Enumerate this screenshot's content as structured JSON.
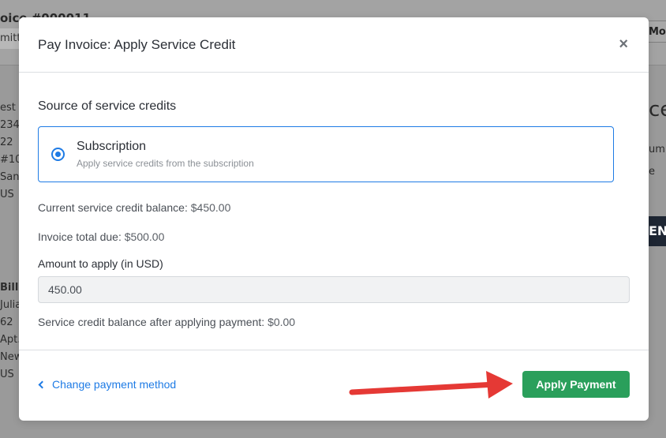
{
  "background": {
    "title": "oice #000011",
    "chip_text": "mitt",
    "more_button": "Mo",
    "left_lines_top": [
      "est",
      "234",
      "22",
      "#105",
      "San",
      "US"
    ],
    "left_lines_bottom_heading": "Bill T",
    "left_lines_bottom": [
      "Julia",
      "62",
      "Apt.",
      "New",
      "US"
    ],
    "right_big": "ce",
    "right_small": [
      "umb",
      "e"
    ],
    "right_block": "EN"
  },
  "modal": {
    "title": "Pay Invoice: Apply Service Credit",
    "close_label": "×",
    "section_title": "Source of service credits",
    "option": {
      "label": "Subscription",
      "description": "Apply service credits from the subscription",
      "selected": true
    },
    "current_balance_label": "Current service credit balance:",
    "current_balance_value": "$450.00",
    "invoice_total_label": "Invoice total due:",
    "invoice_total_value": "$500.00",
    "amount_label": "Amount to apply (in USD)",
    "amount_value": "450.00",
    "after_balance_label": "Service credit balance after applying payment:",
    "after_balance_value": "$0.00",
    "change_link": "Change payment method",
    "apply_button": "Apply Payment"
  },
  "colors": {
    "accent_blue": "#1e7be5",
    "apply_green": "#2a9f5b",
    "arrow_red": "#e53935"
  }
}
